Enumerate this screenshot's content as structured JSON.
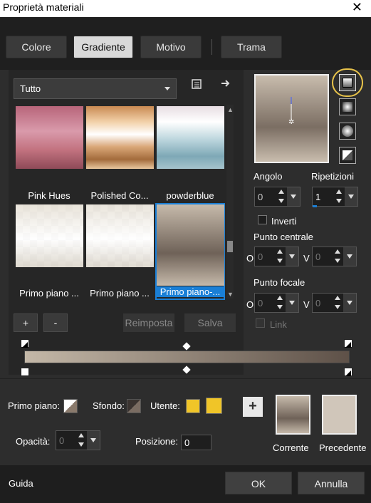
{
  "window": {
    "title": "Proprietà materiali",
    "close_glyph": "✕"
  },
  "tabs": [
    {
      "label": "Colore"
    },
    {
      "label": "Gradiente"
    },
    {
      "label": "Motivo"
    },
    {
      "label": "Trama"
    }
  ],
  "category": {
    "value": "Tutto"
  },
  "gradients": [
    {
      "label": "Pink Hues"
    },
    {
      "label": "Polished Co..."
    },
    {
      "label": "powderblue"
    },
    {
      "label": "Primo piano ..."
    },
    {
      "label": "Primo piano ..."
    },
    {
      "label": "Primo piano-..."
    }
  ],
  "buttons": {
    "add": "+",
    "remove": "-",
    "reset": "Reimposta",
    "save": "Salva"
  },
  "settings": {
    "angle_label": "Angolo",
    "angle_value": "0",
    "repeat_label": "Ripetizioni",
    "repeat_value": "1",
    "invert_label": "Inverti",
    "center_label": "Punto centrale",
    "center_o": "0",
    "center_v": "0",
    "focal_label": "Punto focale",
    "focal_o": "0",
    "focal_v": "0",
    "link_label": "Link",
    "o_label": "O",
    "v_label": "V"
  },
  "bottom": {
    "foreground_label": "Primo piano:",
    "background_label": "Sfondo:",
    "user_label": "Utente:",
    "opacity_label": "Opacità:",
    "opacity_value": "0",
    "position_label": "Posizione:",
    "position_value": "0",
    "current_label": "Corrente",
    "previous_label": "Precedente",
    "plus": "+"
  },
  "footer": {
    "help": "Guida",
    "ok": "OK",
    "cancel": "Annulla"
  },
  "colors": {
    "accent": "#1a7fd6",
    "highlight_ring": "#e8c34a",
    "user_swatch": "#f0c528"
  }
}
